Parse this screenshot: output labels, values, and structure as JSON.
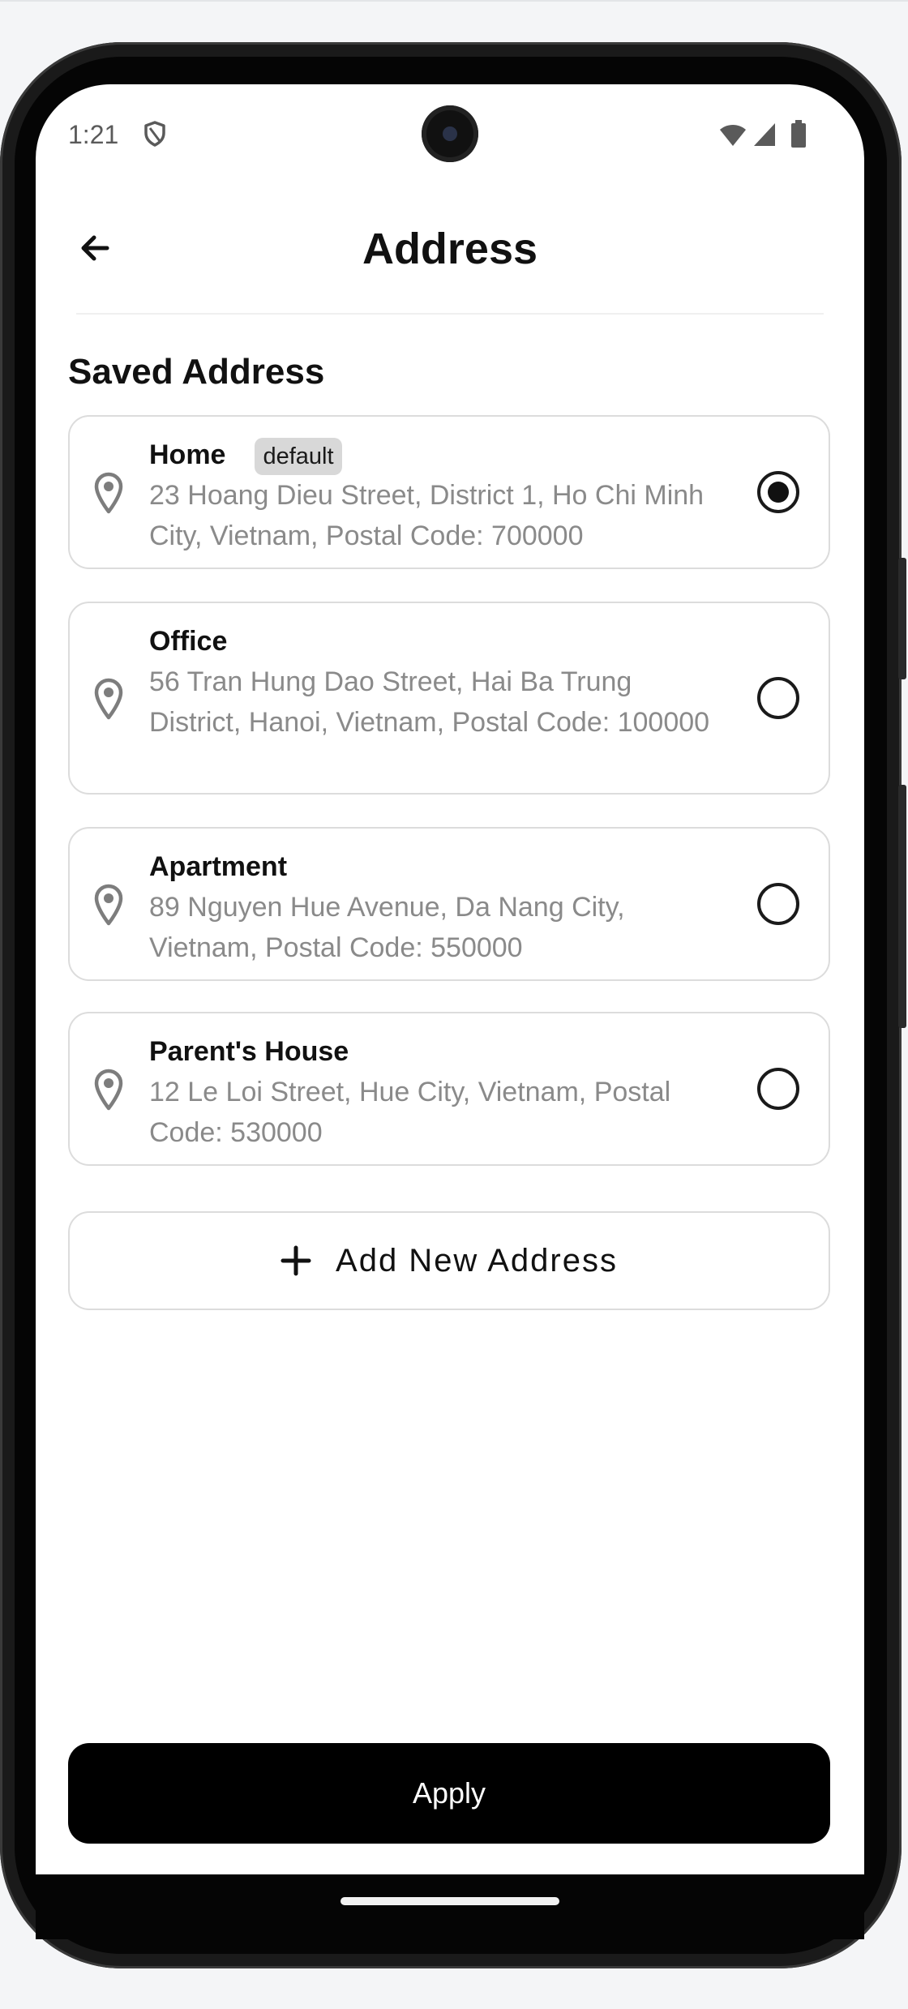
{
  "status_bar": {
    "time": "1:21"
  },
  "header": {
    "title": "Address",
    "back_icon": "arrow-left-icon"
  },
  "section_title": "Saved Address",
  "addresses": [
    {
      "name": "Home",
      "badge": "default",
      "address": "23 Hoang Dieu Street, District 1, Ho Chi Minh City, Vietnam, Postal Code: 700000",
      "selected": true
    },
    {
      "name": "Office",
      "address": "56 Tran Hung Dao Street, Hai Ba Trung District, Hanoi, Vietnam, Postal Code: 100000",
      "selected": false
    },
    {
      "name": "Apartment",
      "address": "89 Nguyen Hue Avenue, Da Nang City, Vietnam, Postal Code: 550000",
      "selected": false
    },
    {
      "name": "Parent's House",
      "address": "12 Le Loi Street, Hue City, Vietnam, Postal Code: 530000",
      "selected": false
    }
  ],
  "add_button": {
    "label": "Add New Address"
  },
  "apply_button": {
    "label": "Apply"
  },
  "colors": {
    "primary": "#000000",
    "muted_text": "#8a8a8a",
    "border": "#dcdcdc",
    "badge_bg": "#d8d8d8"
  }
}
